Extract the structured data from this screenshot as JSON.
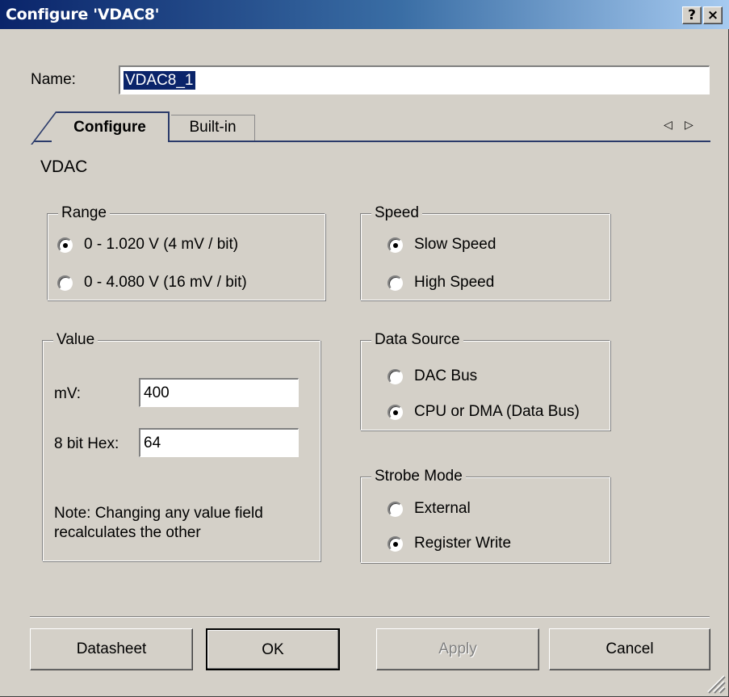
{
  "window": {
    "title": "Configure 'VDAC8'",
    "help_button": "?",
    "close_button": "×"
  },
  "name": {
    "label": "Name:",
    "value": "VDAC8_1"
  },
  "tabs": [
    {
      "label": "Configure",
      "active": true
    },
    {
      "label": "Built-in",
      "active": false
    }
  ],
  "tab_scroll": {
    "left": "◁",
    "right": "▷"
  },
  "section_title": "VDAC",
  "range": {
    "legend": "Range",
    "options": [
      {
        "label": "0 - 1.020 V (4 mV / bit)",
        "selected": true
      },
      {
        "label": "0 - 4.080 V (16 mV / bit)",
        "selected": false
      }
    ]
  },
  "speed": {
    "legend": "Speed",
    "options": [
      {
        "label": "Slow Speed",
        "selected": true
      },
      {
        "label": "High Speed",
        "selected": false
      }
    ]
  },
  "value": {
    "legend": "Value",
    "mv_label": "mV:",
    "mv_value": "400",
    "hex_label": "8 bit Hex:",
    "hex_value": "64",
    "note": "Note: Changing any value field recalculates the other"
  },
  "data_source": {
    "legend": "Data Source",
    "options": [
      {
        "label": "DAC Bus",
        "selected": false
      },
      {
        "label": "CPU or DMA (Data Bus)",
        "selected": true
      }
    ]
  },
  "strobe_mode": {
    "legend": "Strobe Mode",
    "options": [
      {
        "label": "External",
        "selected": false
      },
      {
        "label": "Register Write",
        "selected": true
      }
    ]
  },
  "buttons": {
    "datasheet": "Datasheet",
    "ok": "OK",
    "apply": "Apply",
    "cancel": "Cancel"
  },
  "colors": {
    "title_start": "#0a246a",
    "title_end": "#a6caf0",
    "face": "#d4d0c8",
    "selection": "#0a246a"
  }
}
